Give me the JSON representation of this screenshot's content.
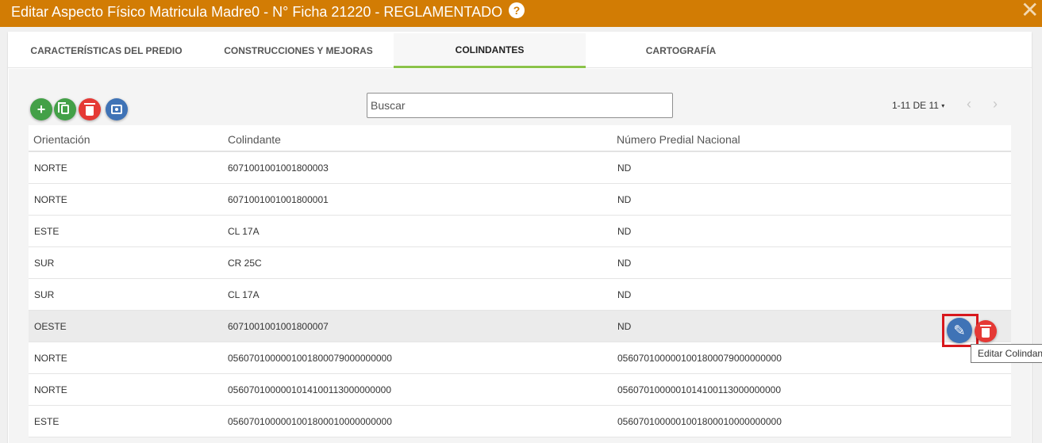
{
  "dialog": {
    "title": "Editar Aspecto Físico Matricula Madre0 - N° Ficha 21220 - REGLAMENTADO",
    "help_icon": "?",
    "close_icon": "✕"
  },
  "tabs": [
    {
      "label": "CARACTERÍSTICAS DEL PREDIO"
    },
    {
      "label": "CONSTRUCCIONES Y MEJORAS"
    },
    {
      "label": "COLINDANTES"
    },
    {
      "label": "CARTOGRAFÍA"
    }
  ],
  "toolbar": {
    "add_icon": "+",
    "copy_icon": "copy-icon",
    "delete_icon": "trash-icon",
    "save_icon": "save-icon"
  },
  "search": {
    "placeholder": "Buscar"
  },
  "pagination": {
    "label": "1-11 DE 11",
    "caret": "▾",
    "prev": "‹",
    "next": "›"
  },
  "table": {
    "columns": [
      "Orientación",
      "Colindante",
      "Número Predial Nacional"
    ],
    "rows": [
      [
        "NORTE",
        "6071001001001800003",
        "ND"
      ],
      [
        "NORTE",
        "6071001001001800001",
        "ND"
      ],
      [
        "ESTE",
        "CL 17A",
        "ND"
      ],
      [
        "SUR",
        "CR 25C",
        "ND"
      ],
      [
        "SUR",
        "CL 17A",
        "ND"
      ],
      [
        "OESTE",
        "6071001001001800007",
        "ND"
      ],
      [
        "NORTE",
        "0560701000001001800079000000000",
        "0560701000001001800079000000000"
      ],
      [
        "NORTE",
        "0560701000001014100113000000000",
        "0560701000001014100113000000000"
      ],
      [
        "ESTE",
        "0560701000001001800010000000000",
        "0560701000001001800010000000000"
      ]
    ]
  },
  "row_actions": {
    "edit_icon": "✎",
    "tooltip": "Editar Colindante"
  },
  "colors": {
    "titlebar": "#d27c04",
    "tab_active_underline": "#8bc34a",
    "add_button": "#43a047",
    "delete_button": "#e53935",
    "edit_button": "#3f73b6",
    "highlight_box": "#d8181c"
  }
}
